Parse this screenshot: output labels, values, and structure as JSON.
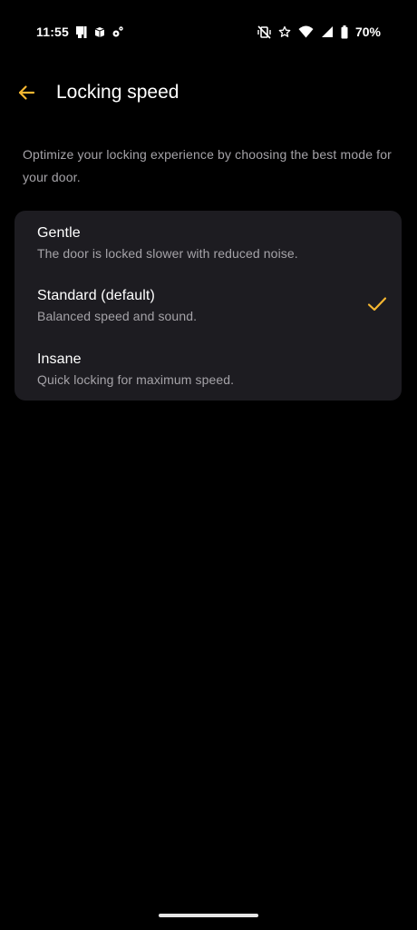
{
  "status_bar": {
    "time": "11:55",
    "battery_percent": "70%",
    "left_icons": [
      "sim-card-icon",
      "cube-icon",
      "settings-icon"
    ],
    "right_icons": [
      "vibrate-off-icon",
      "star-icon",
      "wifi-icon",
      "signal-icon",
      "battery-icon"
    ]
  },
  "app_bar": {
    "title": "Locking speed",
    "back_icon": "arrow-back-icon"
  },
  "description": "Optimize your locking experience by choosing the best mode for your door.",
  "options": [
    {
      "title": "Gentle",
      "description": "The door is locked slower with reduced noise.",
      "selected": false
    },
    {
      "title": "Standard (default)",
      "description": "Balanced speed and sound.",
      "selected": true
    },
    {
      "title": "Insane",
      "description": "Quick locking for maximum speed.",
      "selected": false
    }
  ],
  "colors": {
    "accent": "#f5b731",
    "background": "#000000",
    "card": "#1d1c21",
    "text_primary": "#ffffff",
    "text_secondary": "#a5a3a8"
  }
}
